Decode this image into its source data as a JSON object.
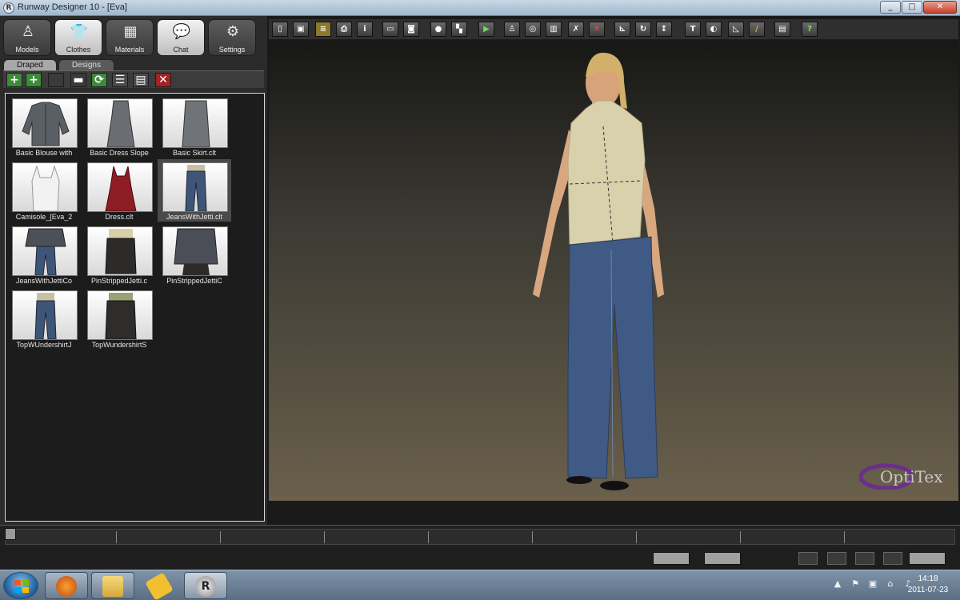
{
  "window": {
    "title": "Runway Designer 10 - [Eva]",
    "app_icon": "R"
  },
  "main_buttons": [
    {
      "label": "Models",
      "icon": "model-icon"
    },
    {
      "label": "Clothes",
      "icon": "shirt-icon",
      "active": true
    },
    {
      "label": "Materials",
      "icon": "checker-icon"
    },
    {
      "label": "Chat",
      "icon": "chat-bubble-icon"
    },
    {
      "label": "Settings",
      "icon": "gear-icon"
    }
  ],
  "tabs": [
    {
      "label": "Draped",
      "active": true
    },
    {
      "label": "Designs",
      "active": false
    }
  ],
  "thumbnails": [
    {
      "caption": "Basic Blouse with",
      "garment": "blouse"
    },
    {
      "caption": "Basic Dress Slope",
      "garment": "dress"
    },
    {
      "caption": "Basic Skirt.clt",
      "garment": "skirt"
    },
    {
      "caption": "Camisole_[Eva_2",
      "garment": "camisole"
    },
    {
      "caption": "Dress.clt",
      "garment": "red-dress"
    },
    {
      "caption": "JeansWithJetti.clt",
      "garment": "jeans",
      "selected": true
    },
    {
      "caption": "JeansWithJettiCo",
      "garment": "jeans-coat"
    },
    {
      "caption": "PinStrippedJetti.c",
      "garment": "pinstripe-skirt"
    },
    {
      "caption": "PinStrippedJettiC",
      "garment": "pinstripe-coat"
    },
    {
      "caption": "TopWUndershirtJ",
      "garment": "top-jeans"
    },
    {
      "caption": "TopWundershirtS",
      "garment": "top-skirt"
    }
  ],
  "toolbar_icons": [
    "new-icon",
    "save-icon",
    "layers-icon",
    "print-icon",
    "info-icon",
    "flatten-icon",
    "camera-icon",
    "sphere-icon",
    "checker-icon",
    "play-icon",
    "avatar-icon",
    "target-icon",
    "split-icon",
    "erase-icon",
    "delete-icon",
    "axes-icon",
    "rotate-icon",
    "updown-icon",
    "text-icon",
    "fabric-icon",
    "ruler-icon",
    "pencil-icon",
    "export-icon",
    "help-icon"
  ],
  "viewport": {
    "logo": "OptiTex",
    "logo_sub": ""
  },
  "clock": {
    "time": "14:18",
    "date": "2011-07-23"
  },
  "colors": {
    "accent_green": "#3c8a3a",
    "delete_red": "#a32222",
    "optitex_purple": "#6a2f8a"
  }
}
